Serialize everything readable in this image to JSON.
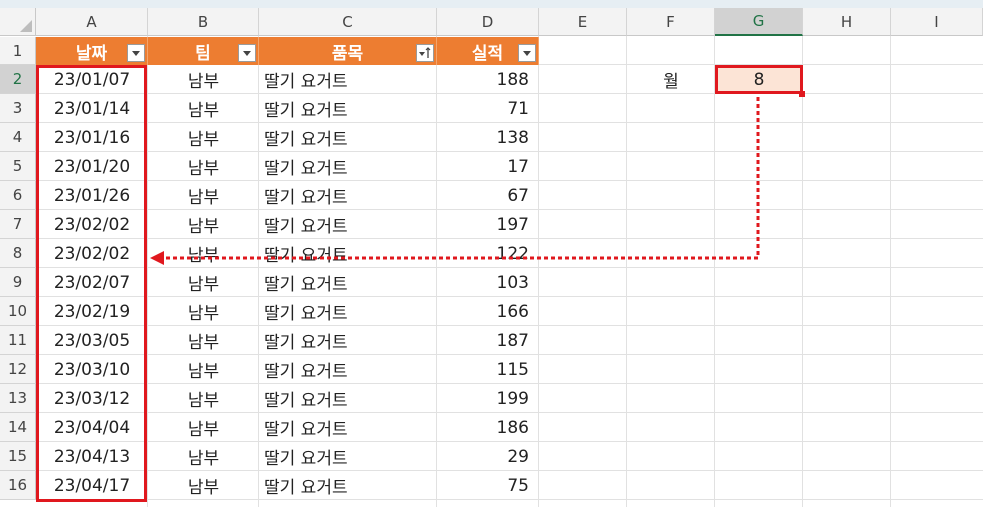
{
  "columns": [
    "A",
    "B",
    "C",
    "D",
    "E",
    "F",
    "G",
    "H",
    "I"
  ],
  "rows": [
    "1",
    "2",
    "3",
    "4",
    "5",
    "6",
    "7",
    "8",
    "9",
    "10",
    "11",
    "12",
    "13",
    "14",
    "15",
    "16"
  ],
  "selected_column": "G",
  "selected_row": "2",
  "table": {
    "headers": [
      "날짜",
      "팀",
      "품목",
      "실적"
    ],
    "data": [
      [
        "23/01/07",
        "남부",
        "딸기 요거트",
        "188"
      ],
      [
        "23/01/14",
        "남부",
        "딸기 요거트",
        "71"
      ],
      [
        "23/01/16",
        "남부",
        "딸기 요거트",
        "138"
      ],
      [
        "23/01/20",
        "남부",
        "딸기 요거트",
        "17"
      ],
      [
        "23/01/26",
        "남부",
        "딸기 요거트",
        "67"
      ],
      [
        "23/02/02",
        "남부",
        "딸기 요거트",
        "197"
      ],
      [
        "23/02/02",
        "남부",
        "딸기 요거트",
        "122"
      ],
      [
        "23/02/07",
        "남부",
        "딸기 요거트",
        "103"
      ],
      [
        "23/02/19",
        "남부",
        "딸기 요거트",
        "166"
      ],
      [
        "23/03/05",
        "남부",
        "딸기 요거트",
        "187"
      ],
      [
        "23/03/10",
        "남부",
        "딸기 요거트",
        "115"
      ],
      [
        "23/03/12",
        "남부",
        "딸기 요거트",
        "199"
      ],
      [
        "23/04/04",
        "남부",
        "딸기 요거트",
        "186"
      ],
      [
        "23/04/13",
        "남부",
        "딸기 요거트",
        "29"
      ],
      [
        "23/04/17",
        "남부",
        "딸기 요거트",
        "75"
      ]
    ]
  },
  "lookup": {
    "label": "월",
    "value": "8"
  },
  "colors": {
    "header_fill": "#ed7d31",
    "highlight_fill": "#fce4d6",
    "annotation_red": "#e0181e",
    "excel_green": "#217346"
  },
  "icons": {
    "filter_dropdown": "dropdown-arrow-icon",
    "filter_sorted": "sort-ascending-filter-icon"
  }
}
